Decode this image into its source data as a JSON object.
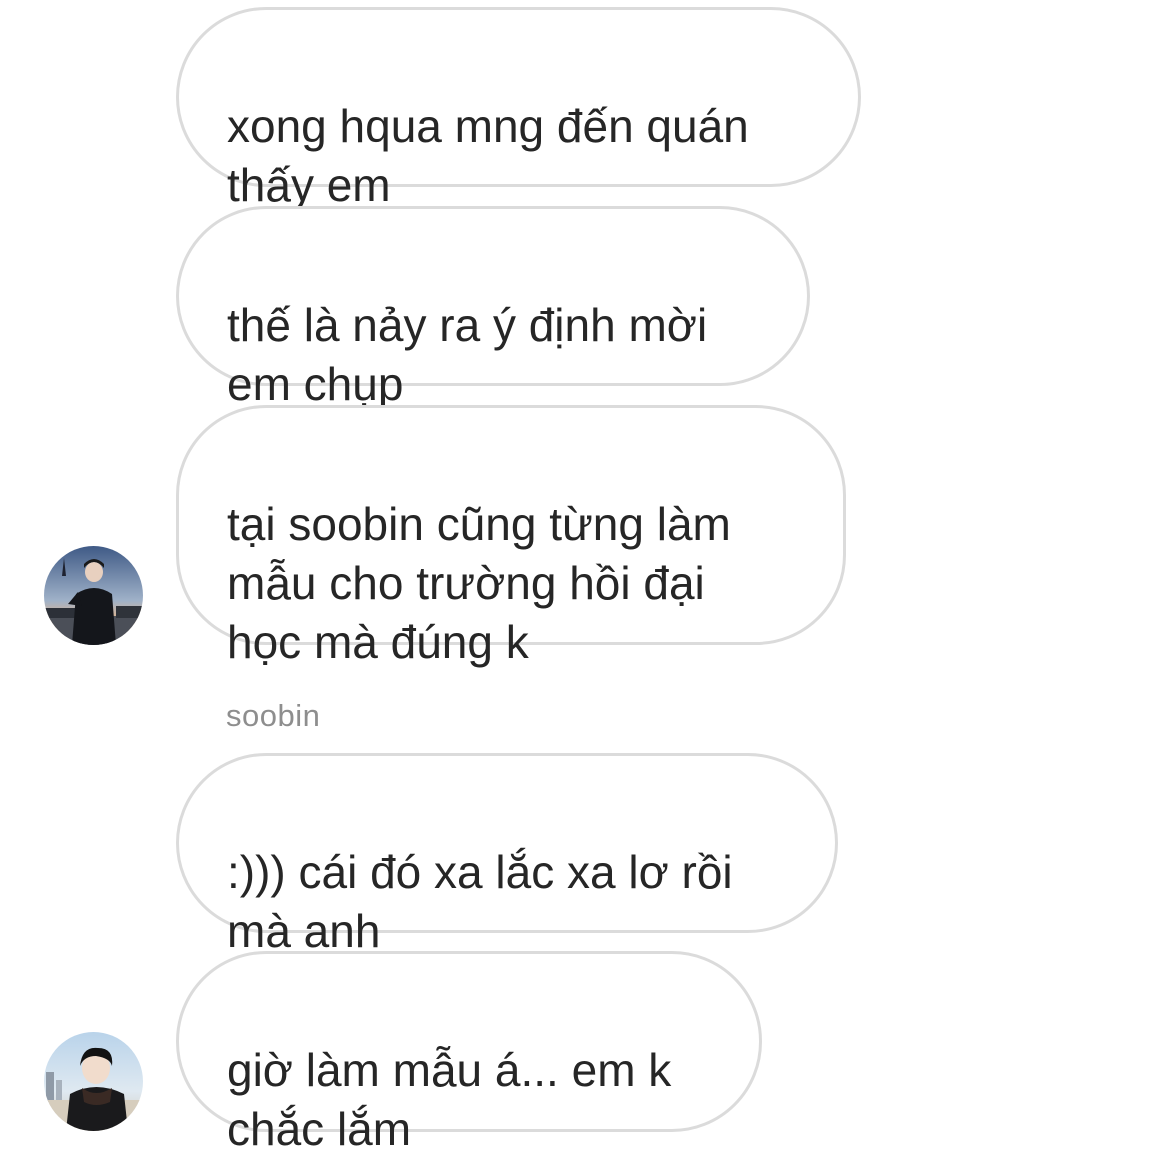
{
  "thread": {
    "messages": [
      {
        "text": "xong hqua mng đến quán\nthấy em"
      },
      {
        "text": "thế là nảy ra ý định mời\nem chụp"
      },
      {
        "text": "tại soobin cũng từng làm\nmẫu cho trường hồi đại\nhọc mà đúng k"
      },
      {
        "text": ":))) cái đó xa lắc xa lơ rồi\nmà anh"
      },
      {
        "text": "giờ làm mẫu á... em k\nchắc lắm"
      }
    ],
    "sender_label": "soobin"
  },
  "avatars": {
    "first": {
      "icon": "profile-photo-icon"
    },
    "second": {
      "icon": "profile-photo-icon"
    }
  }
}
